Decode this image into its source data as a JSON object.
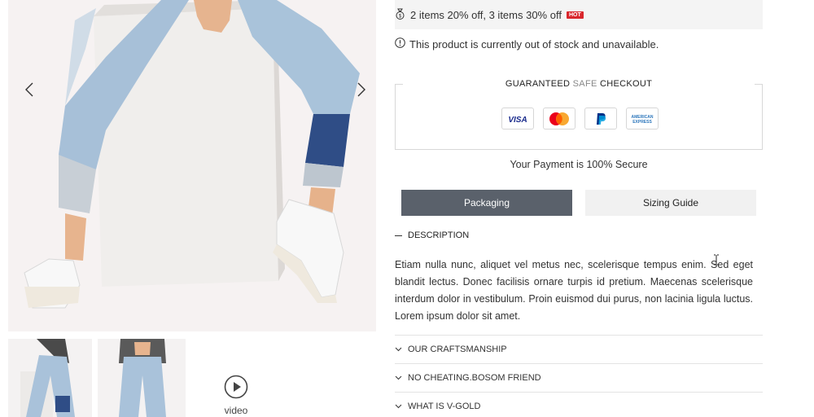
{
  "promo": {
    "text": "2 items 20% off, 3 items 30% off",
    "badge": "HOT",
    "icon": "money-bag-icon"
  },
  "stock": {
    "text": "This product is currently out of stock and unavailable.",
    "icon": "info-circle-icon"
  },
  "checkout": {
    "title_prefix": "GUARANTEED",
    "title_safe": "SAFE",
    "title_suffix": "CHECKOUT",
    "cards": [
      "VISA",
      "Mastercard",
      "PayPal",
      "American Express"
    ],
    "secure_text": "Your Payment is 100% Secure"
  },
  "tabs": {
    "packaging": "Packaging",
    "sizing": "Sizing Guide"
  },
  "description": {
    "heading": "DESCRIPTION",
    "body": "Etiam nulla nunc, aliquet vel metus nec, scelerisque tempus enim. Sed eget blandit lectus. Donec facilisis ornare turpis id pretium. Maecenas scelerisque interdum dolor in vestibulum. Proin euismod dui purus, non lacinia ligula luctus. Lorem ipsum dolor sit amet."
  },
  "accordion": {
    "craftsmanship": "OUR CRAFTSMANSHIP",
    "no_cheating": "NO CHEATING.BOSOM FRIEND",
    "v_gold": "WHAT IS V-GOLD"
  },
  "gallery": {
    "video_label": "video"
  },
  "colors": {
    "accent_tab": "#5a616b",
    "hot_badge": "#d9262c",
    "promo_bg": "#f4f4f4"
  }
}
